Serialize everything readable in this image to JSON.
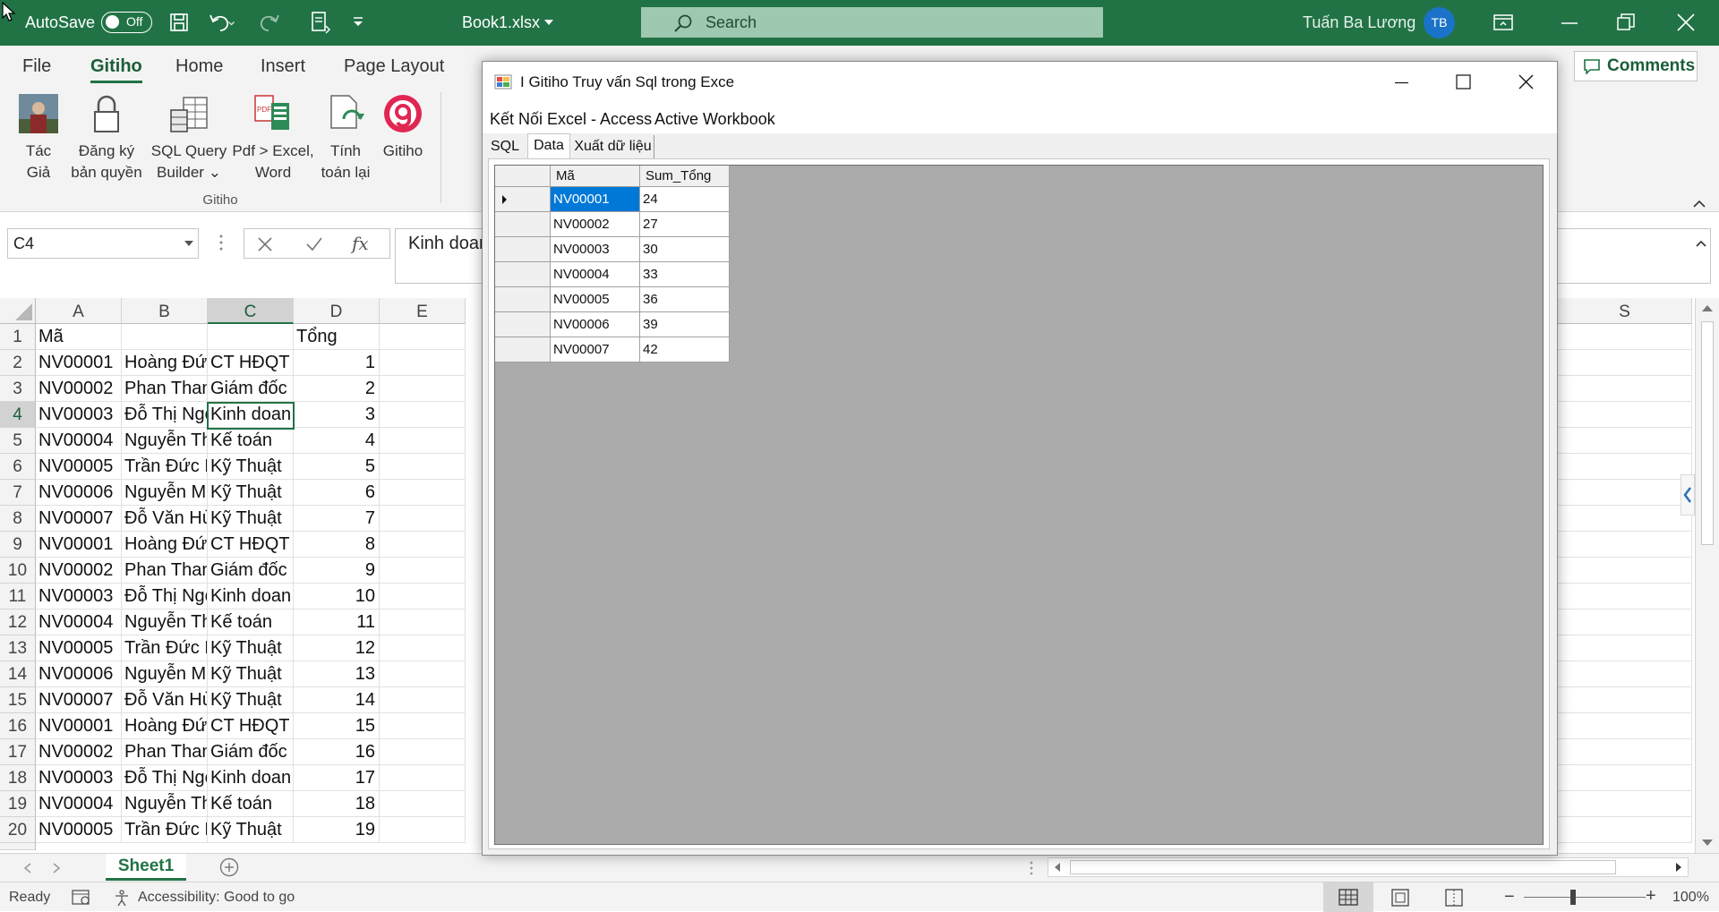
{
  "titlebar": {
    "autosave_label": "AutoSave",
    "autosave_state": "Off",
    "filename": "Book1.xlsx",
    "search_placeholder": "Search",
    "user_name": "Tuấn Ba Lương",
    "user_initials": "TB"
  },
  "ribbon_tabs": [
    "File",
    "Gitiho",
    "Home",
    "Insert",
    "Page Layout"
  ],
  "ribbon_active_tab": "Gitiho",
  "comments_label": "Comments",
  "ribbon_group": {
    "name": "Gitiho",
    "buttons": [
      {
        "label1": "Tác",
        "label2": "Giả",
        "icon": "author-photo-icon"
      },
      {
        "label1": "Đăng ký",
        "label2": "bản quyền",
        "icon": "lock-icon"
      },
      {
        "label1": "SQL Query",
        "label2": "Builder ⌄",
        "icon": "sql-query-builder-icon"
      },
      {
        "label1": "Pdf > Excel,",
        "label2": "Word",
        "icon": "pdf-convert-icon"
      },
      {
        "label1": "Tính",
        "label2": "toán lại",
        "icon": "recalculate-icon"
      },
      {
        "label1": "Gitiho",
        "label2": "",
        "icon": "gitiho-logo-icon"
      }
    ]
  },
  "formula": {
    "name_box": "C4",
    "content": "Kinh doan"
  },
  "columns": [
    "A",
    "B",
    "C",
    "D",
    "E",
    "S"
  ],
  "sheet": {
    "header_row": {
      "row": "1",
      "A": "Mã",
      "B": "",
      "C": "",
      "D": "Tổng"
    },
    "rows": [
      {
        "row": "2",
        "A": "NV00001",
        "B": "Hoàng Đức",
        "C": "CT HĐQT",
        "D": "1"
      },
      {
        "row": "3",
        "A": "NV00002",
        "B": "Phan Thanh",
        "C": "Giám đốc",
        "D": "2"
      },
      {
        "row": "4",
        "A": "NV00003",
        "B": "Đỗ Thị Ngọc",
        "C": "Kinh doan",
        "D": "3"
      },
      {
        "row": "5",
        "A": "NV00004",
        "B": "Nguyễn Thị",
        "C": "Kế toán",
        "D": "4"
      },
      {
        "row": "6",
        "A": "NV00005",
        "B": "Trần Đức H",
        "C": "Kỹ Thuật",
        "D": "5"
      },
      {
        "row": "7",
        "A": "NV00006",
        "B": "Nguyễn Mạnh",
        "C": "Kỹ Thuật",
        "D": "6"
      },
      {
        "row": "8",
        "A": "NV00007",
        "B": "Đỗ Văn Hùng",
        "C": "Kỹ Thuật",
        "D": "7"
      },
      {
        "row": "9",
        "A": "NV00001",
        "B": "Hoàng Đức",
        "C": "CT HĐQT",
        "D": "8"
      },
      {
        "row": "10",
        "A": "NV00002",
        "B": "Phan Thanh",
        "C": "Giám đốc",
        "D": "9"
      },
      {
        "row": "11",
        "A": "NV00003",
        "B": "Đỗ Thị Ngọc",
        "C": "Kinh doan",
        "D": "10"
      },
      {
        "row": "12",
        "A": "NV00004",
        "B": "Nguyễn Thị",
        "C": "Kế toán",
        "D": "11"
      },
      {
        "row": "13",
        "A": "NV00005",
        "B": "Trần Đức H",
        "C": "Kỹ Thuật",
        "D": "12"
      },
      {
        "row": "14",
        "A": "NV00006",
        "B": "Nguyễn Mạnh",
        "C": "Kỹ Thuật",
        "D": "13"
      },
      {
        "row": "15",
        "A": "NV00007",
        "B": "Đỗ Văn Hùng",
        "C": "Kỹ Thuật",
        "D": "14"
      },
      {
        "row": "16",
        "A": "NV00001",
        "B": "Hoàng Đức",
        "C": "CT HĐQT",
        "D": "15"
      },
      {
        "row": "17",
        "A": "NV00002",
        "B": "Phan Thanh",
        "C": "Giám đốc",
        "D": "16"
      },
      {
        "row": "18",
        "A": "NV00003",
        "B": "Đỗ Thị Ngọc",
        "C": "Kinh doan",
        "D": "17"
      },
      {
        "row": "19",
        "A": "NV00004",
        "B": "Nguyễn Thị",
        "C": "Kế toán",
        "D": "18"
      },
      {
        "row": "20",
        "A": "NV00005",
        "B": "Trần Đức H",
        "C": "Kỹ Thuật",
        "D": "19"
      }
    ]
  },
  "sheet_tab": "Sheet1",
  "status": {
    "ready": "Ready",
    "accessibility": "Accessibility: Good to go",
    "zoom": "100%"
  },
  "dialog": {
    "title": "I Gitiho Truy vấn Sql trong Exce",
    "menu": [
      "Kết Nối Excel - Access",
      "Active Workbook"
    ],
    "tabs": [
      "SQL",
      "Data",
      "Xuất dữ liệu"
    ],
    "active_tab": "Data",
    "grid_headers": [
      "Mã",
      "Sum_Tổng"
    ],
    "grid_rows": [
      [
        "NV00001",
        "24"
      ],
      [
        "NV00002",
        "27"
      ],
      [
        "NV00003",
        "30"
      ],
      [
        "NV00004",
        "33"
      ],
      [
        "NV00005",
        "36"
      ],
      [
        "NV00006",
        "39"
      ],
      [
        "NV00007",
        "42"
      ]
    ]
  },
  "colors": {
    "excel_green": "#217346",
    "selection_blue": "#0078d7",
    "grid_background": "#ababab"
  }
}
